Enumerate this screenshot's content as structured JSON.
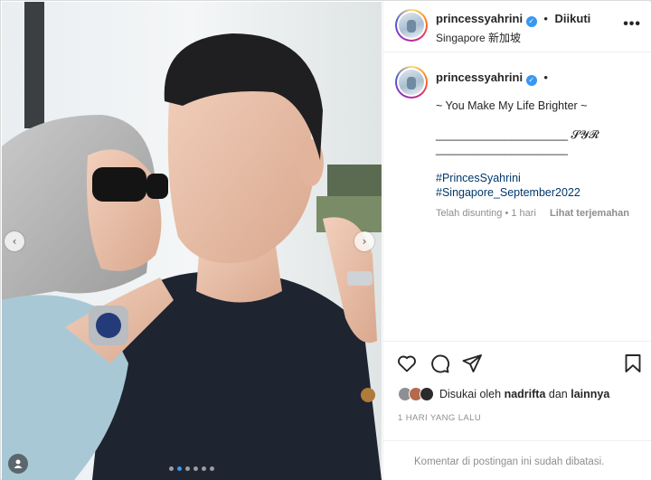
{
  "post": {
    "username": "princessyahrini",
    "follow_status": "Diikuti",
    "location": "Singapore 新加坡",
    "more_label": "•••",
    "verified_mark": "✓",
    "separator": "•"
  },
  "caption": {
    "username": "princessyahrini",
    "lines": [
      "~ You Make My Life Brighter ~",
      "",
      "_____________________ 𝓢𝓨𝓡",
      "_____________________",
      ""
    ],
    "hashtags": [
      "#PrincesSyahrini",
      "#Singapore_September2022"
    ],
    "edited_label": "Telah disunting",
    "edited_time": "1 hari",
    "translate_label": "Lihat terjemahan"
  },
  "actions": {
    "icons": [
      "heart-icon",
      "comment-icon",
      "share-icon",
      "bookmark-icon"
    ],
    "liked_by_prefix": "Disukai oleh",
    "liked_by_user": "nadrifta",
    "liked_by_and": "dan",
    "liked_by_others": "lainnya",
    "timestamp": "1 HARI YANG LALU",
    "comments_disabled": "Komentar di postingan ini sudah dibatasi."
  },
  "carousel": {
    "prev_glyph": "‹",
    "next_glyph": "›",
    "dot_count": 6,
    "active_dot": 1
  },
  "colors": {
    "accent": "#3897f0",
    "hashtag": "#00376b",
    "muted": "#8e8e8e",
    "text": "#262626"
  }
}
